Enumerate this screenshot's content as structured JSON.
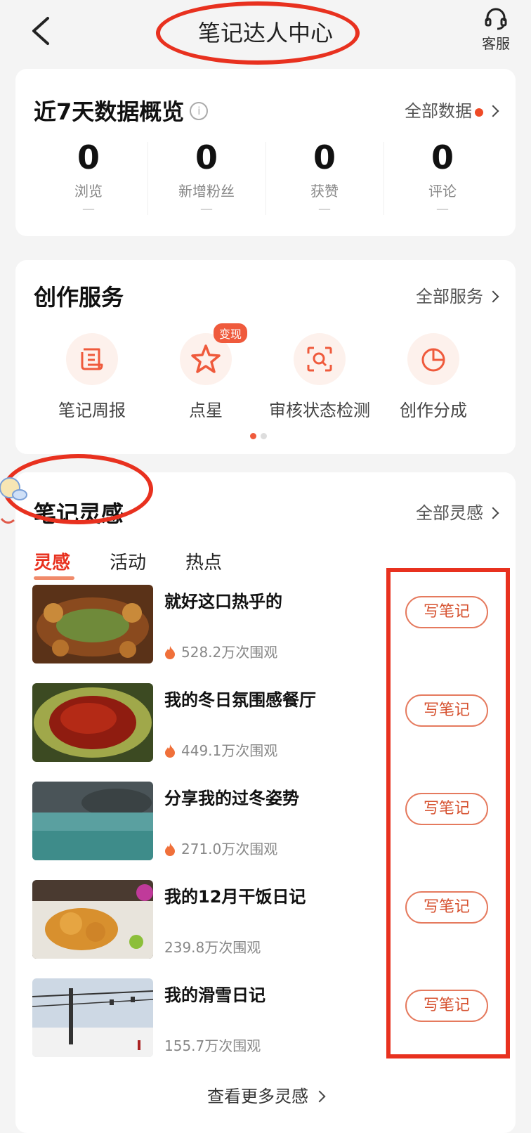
{
  "header": {
    "title": "笔记达人中心",
    "service_label": "客服"
  },
  "overview": {
    "title": "近7天数据概览",
    "info_icon": "i",
    "more_label": "全部数据",
    "stats": [
      {
        "value": "0",
        "label": "浏览",
        "sub": "—"
      },
      {
        "value": "0",
        "label": "新增粉丝",
        "sub": "—"
      },
      {
        "value": "0",
        "label": "获赞",
        "sub": "—"
      },
      {
        "value": "0",
        "label": "评论",
        "sub": "—"
      }
    ]
  },
  "services": {
    "title": "创作服务",
    "more_label": "全部服务",
    "items": [
      {
        "label": "笔记周报",
        "icon": "report-icon"
      },
      {
        "label": "点星",
        "icon": "star-icon",
        "badge": "变现"
      },
      {
        "label": "审核状态检测",
        "icon": "scan-search-icon"
      },
      {
        "label": "创作分成",
        "icon": "pie-chart-icon"
      }
    ],
    "page_count": 2,
    "current_page": 1
  },
  "inspiration": {
    "title": "笔记灵感",
    "more_label": "全部灵感",
    "tabs": [
      "灵感",
      "活动",
      "热点"
    ],
    "active_tab": 0,
    "items": [
      {
        "title": "就好这口热乎的",
        "views": "528.2万次围观",
        "hot": true,
        "button": "写笔记"
      },
      {
        "title": "我的冬日氛围感餐厅",
        "views": "449.1万次围观",
        "hot": true,
        "button": "写笔记"
      },
      {
        "title": "分享我的过冬姿势",
        "views": "271.0万次围观",
        "hot": true,
        "button": "写笔记"
      },
      {
        "title": "我的12月干饭日记",
        "views": "239.8万次围观",
        "hot": false,
        "button": "写笔记"
      },
      {
        "title": "我的滑雪日记",
        "views": "155.7万次围观",
        "hot": false,
        "button": "写笔记"
      }
    ],
    "see_more": "查看更多灵感"
  },
  "colors": {
    "accent": "#ef4a26",
    "annotation": "#e8311f"
  }
}
